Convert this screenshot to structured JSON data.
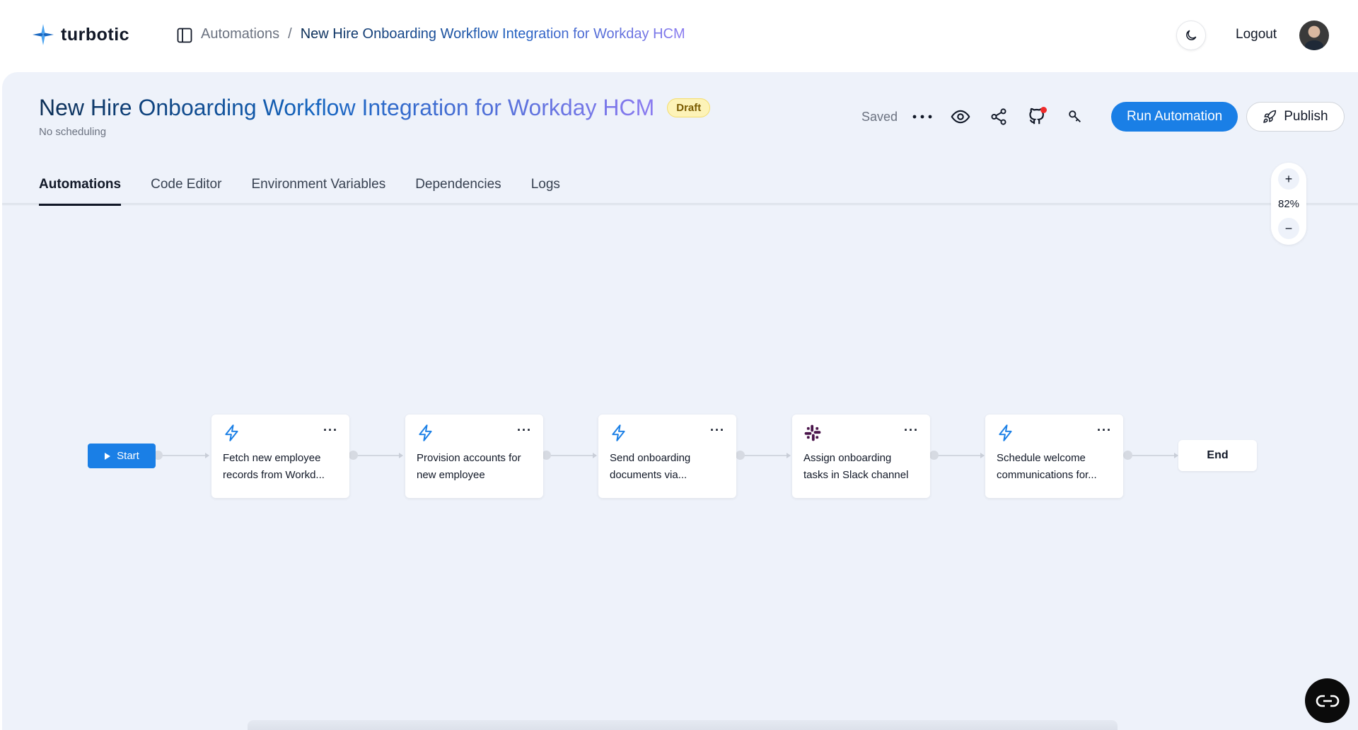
{
  "app": {
    "brand": "turbotic"
  },
  "breadcrumb": {
    "parent": "Automations",
    "separator": "/",
    "current": "New Hire Onboarding Workflow Integration for Workday HCM"
  },
  "header_actions": {
    "logout": "Logout"
  },
  "automation": {
    "title": "New Hire Onboarding Workflow Integration for Workday HCM",
    "badge": "Draft",
    "schedule": "No scheduling",
    "saved_status": "Saved",
    "run_label": "Run Automation",
    "publish_label": "Publish"
  },
  "tabs": [
    {
      "label": "Automations",
      "active": true
    },
    {
      "label": "Code Editor",
      "active": false
    },
    {
      "label": "Environment Variables",
      "active": false
    },
    {
      "label": "Dependencies",
      "active": false
    },
    {
      "label": "Logs",
      "active": false
    }
  ],
  "zoom": {
    "level": "82%",
    "in": "+",
    "out": "−"
  },
  "flow": {
    "start_label": "Start",
    "end_label": "End",
    "steps": [
      {
        "icon": "lightning-icon",
        "label": "Fetch new employee records from Workd..."
      },
      {
        "icon": "lightning-icon",
        "label": "Provision accounts for new employee"
      },
      {
        "icon": "lightning-icon",
        "label": "Send onboarding documents via..."
      },
      {
        "icon": "slack-icon",
        "label": "Assign onboarding tasks in Slack channel"
      },
      {
        "icon": "lightning-icon",
        "label": "Schedule welcome communications for..."
      }
    ]
  },
  "colors": {
    "accent": "#1a7fe6",
    "canvas_bg": "#eef2fa",
    "draft_badge_bg": "#fdf3b8",
    "github_notification": "#ef2b2b",
    "slack_purple": "#4a154b"
  }
}
